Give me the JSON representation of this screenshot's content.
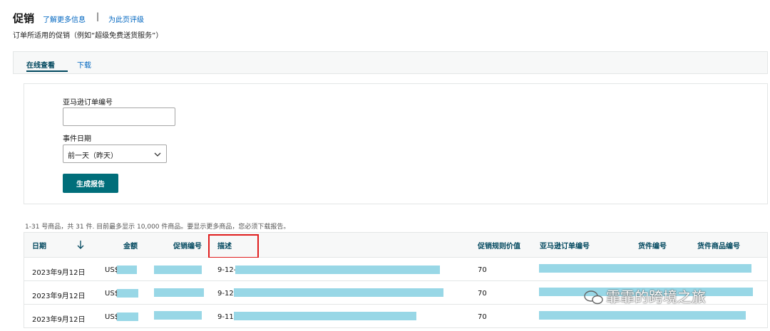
{
  "header": {
    "title": "促销",
    "learn_more": "了解更多信息",
    "separator": "|",
    "rate_page": "为此页评级",
    "subtitle": "订单所适用的促销（例如“超级免费送货服务”）"
  },
  "tabs": [
    {
      "label": "在线查看",
      "active": true
    },
    {
      "label": "下载",
      "active": false
    }
  ],
  "form": {
    "order_id_label": "亚马逊订单编号",
    "order_id_value": "",
    "event_date_label": "事件日期",
    "event_date_value": "前一天（昨天）",
    "generate_label": "生成报告"
  },
  "info_text": "1-31 号商品，共 31 件. 目前最多显示 10,000 件商品。要显示更多商品，您必须下载报告。",
  "table": {
    "columns": [
      "日期",
      "金额",
      "促销编号",
      "描述",
      "促销规则价值",
      "亚马逊订单编号",
      "货件编号",
      "货件商品编号"
    ],
    "rows": [
      {
        "date": "2023年9月12日",
        "amount": "US$",
        "promo_id": "",
        "desc": "9-12-",
        "rule_value": "70"
      },
      {
        "date": "2023年9月12日",
        "amount": "US$",
        "promo_id": "",
        "desc": "9-12-",
        "rule_value": "70"
      },
      {
        "date": "2023年9月12日",
        "amount": "US$",
        "promo_id": "",
        "desc": "9-11-",
        "rule_value": "70"
      }
    ]
  },
  "watermark": "霏霏的跨境之旅",
  "colors": {
    "link": "#0066c0",
    "teal_button": "#006e7a",
    "header_text": "#00475e",
    "redaction": "#98d7e6",
    "highlight": "#e01e1e"
  }
}
